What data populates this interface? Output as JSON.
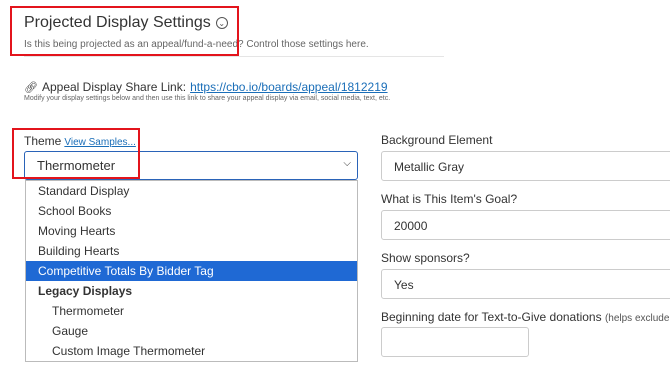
{
  "header": {
    "title": "Projected Display Settings",
    "subtitle": "Is this being projected as an appeal/fund-a-need? Control those settings here."
  },
  "share": {
    "label": "Appeal Display Share Link:",
    "url": "https://cbo.io/boards/appeal/1812219",
    "note": "Modify your display settings below and then use this link to share your appeal display via email, social media, text, etc."
  },
  "theme": {
    "label": "Theme",
    "view_samples": "View Samples...",
    "selected": "Thermometer",
    "options": [
      {
        "label": "Standard Display",
        "kind": "option"
      },
      {
        "label": "School Books",
        "kind": "option"
      },
      {
        "label": "Moving Hearts",
        "kind": "option"
      },
      {
        "label": "Building Hearts",
        "kind": "option"
      },
      {
        "label": "Competitive Totals By Bidder Tag",
        "kind": "highlighted"
      },
      {
        "label": "Legacy Displays",
        "kind": "group"
      },
      {
        "label": "Thermometer",
        "kind": "sub"
      },
      {
        "label": "Gauge",
        "kind": "sub"
      },
      {
        "label": "Custom Image Thermometer",
        "kind": "sub"
      }
    ]
  },
  "right": {
    "background_label": "Background Element",
    "background_value": "Metallic Gray",
    "goal_label": "What is This Item's Goal?",
    "goal_value": "20000",
    "sponsors_label": "Show sponsors?",
    "sponsors_value": "Yes",
    "date_label": "Beginning date for Text-to-Give donations",
    "date_hint": "(helps exclude older",
    "date_value": ""
  },
  "colors": {
    "highlight": "#e3141c",
    "accent": "#1f69d4",
    "link": "#1a6eb8"
  }
}
